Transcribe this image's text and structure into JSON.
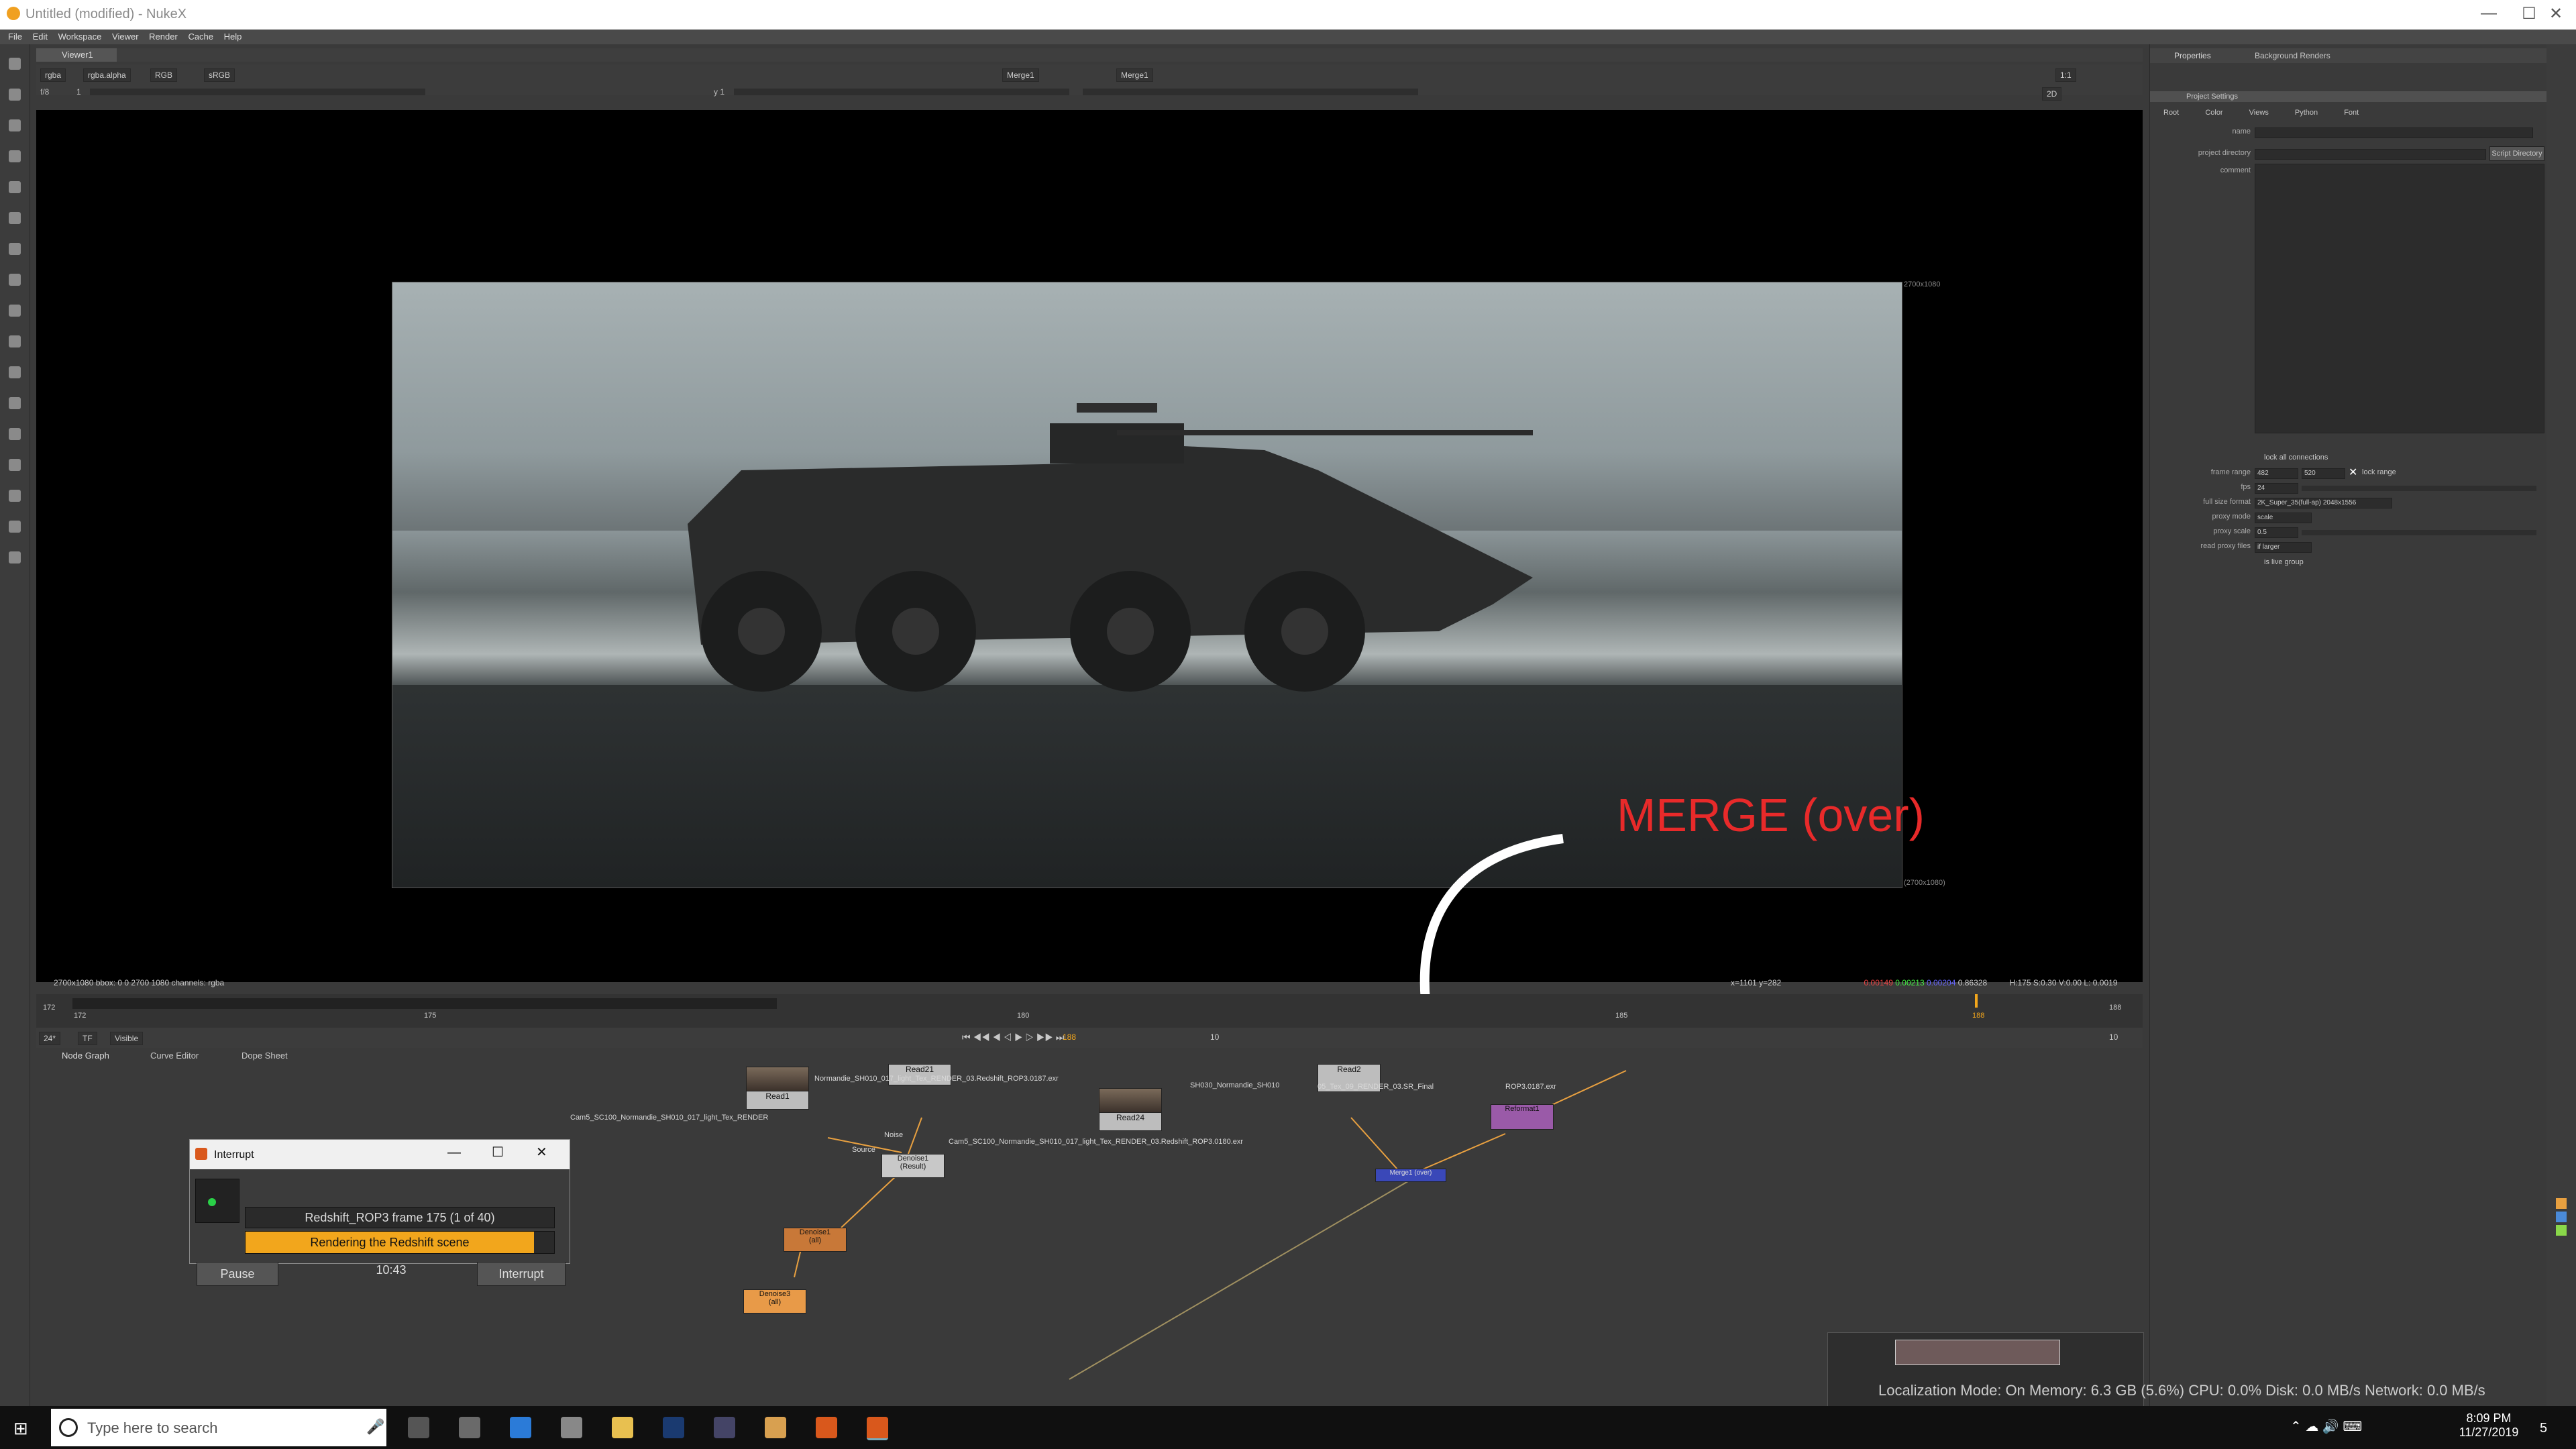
{
  "window": {
    "title": "Untitled (modified) - NukeX",
    "controls": [
      "—",
      "☐",
      "✕"
    ]
  },
  "menu": [
    "File",
    "Edit",
    "Workspace",
    "Viewer",
    "Render",
    "Cache",
    "Help"
  ],
  "viewer": {
    "tab": "Viewer1",
    "channels": "rgba",
    "alpha": "rgba.alpha",
    "colorspace_a": "RGB",
    "lut": "sRGB",
    "input_a": "Merge1",
    "input_b": "Merge1",
    "zoom": "1:1",
    "view_mode": "2D",
    "frame_label": "f/8",
    "gain_label": "1",
    "gamma_label": "y 1",
    "format_top": "2700x1080",
    "format_bottom": "(2700x1080)",
    "info": "2700x1080  bbox: 0 0 2700 1080 channels: rgba",
    "coords": "x=1101 y=282",
    "pixel_values": [
      "0.00149",
      "0.00213",
      "0.00204",
      "0.86328"
    ],
    "hsv": "H:175 S:0.30 V:0.00  L: 0.0019"
  },
  "overlay": {
    "label": "MERGE (over)"
  },
  "timeline": {
    "fps": "24*",
    "tf": "TF",
    "visible": "Visible",
    "ticks": [
      "172",
      "175",
      "180",
      "185",
      "188"
    ],
    "start": "172",
    "end": "188",
    "current_frame": "188",
    "step": "10",
    "frame_out": "10"
  },
  "nodegraph": {
    "tabs": [
      "Node Graph",
      "Curve Editor",
      "Dope Sheet"
    ],
    "nodes": {
      "read1": "Read1",
      "read1_file": "Cam5_SC100_Normandie_SH010_017_light_Tex_RENDER",
      "read21": "Read21",
      "read21_file": "Normandie_SH010_017_light_Tex_RENDER_03.Redshift_ROP3.0187.exr",
      "read24": "Read24",
      "read24_file": "Cam5_SC100_Normandie_SH010_017_light_Tex_RENDER_03.Redshift_ROP3.0180.exr",
      "read2": "Read2",
      "read2_file": "05_Tex_09_RENDER_03.SR_Final",
      "denoise1": "Denoise1",
      "denoise1_sub": "(Result)",
      "denoise2": "Denoise1",
      "denoise2_sub": "(all)",
      "denoise3": "Denoise3",
      "denoise3_sub": "(all)",
      "merge1": "Merge1 (over)",
      "reformat1": "Reformat1",
      "noise": "Noise",
      "source": "Source",
      "mid_label": "SH030_Normandie_SH010",
      "exr_label": "ROP3.0187.exr"
    }
  },
  "dialog": {
    "title": "Interrupt",
    "job": "Redshift_ROP3 frame 175 (1 of 40)",
    "status": "Rendering the Redshift scene",
    "progress": 0.93,
    "elapsed": "10:43",
    "pause_label": "Pause",
    "interrupt_label": "Interrupt"
  },
  "properties": {
    "tabs": [
      "Properties",
      "Background Renders"
    ],
    "panel_title": "Project Settings",
    "subtabs": [
      "Root",
      "Color",
      "Views",
      "Python",
      "Font"
    ],
    "fields": {
      "name_label": "name",
      "project_directory_label": "project directory",
      "script_directory_button": "Script Directory",
      "comment_label": "comment",
      "lock_all_connections": "lock all connections",
      "frame_range_label": "frame range",
      "frame_start": "482",
      "frame_end": "520",
      "lock_range": "lock range",
      "fps_label": "fps",
      "fps_value": "24",
      "full_size_format_label": "full size format",
      "full_size_format_value": "2K_Super_35(full-ap) 2048x1556",
      "proxy_mode_label": "proxy mode",
      "proxy_mode_value": "scale",
      "proxy_scale_label": "proxy scale",
      "proxy_scale_value": "0.5",
      "read_proxy_files_label": "read proxy files",
      "read_proxy_files_value": "if larger",
      "is_live_group": "is live group"
    }
  },
  "status": {
    "text": "Localization Mode: On  Memory: 6.3 GB (5.6%)  CPU: 0.0%  Disk: 0.0 MB/s  Network: 0.0 MB/s"
  },
  "taskbar": {
    "search_placeholder": "Type here to search",
    "time": "8:09 PM",
    "date": "11/27/2019",
    "notifications": "5"
  },
  "colors": {
    "accent_orange": "#f2a61c",
    "merge_blue": "#3a48b8",
    "denoise_orange": "#c87838",
    "overlay_red": "#e82a2a",
    "reformat_purple": "#9a5aa8"
  }
}
